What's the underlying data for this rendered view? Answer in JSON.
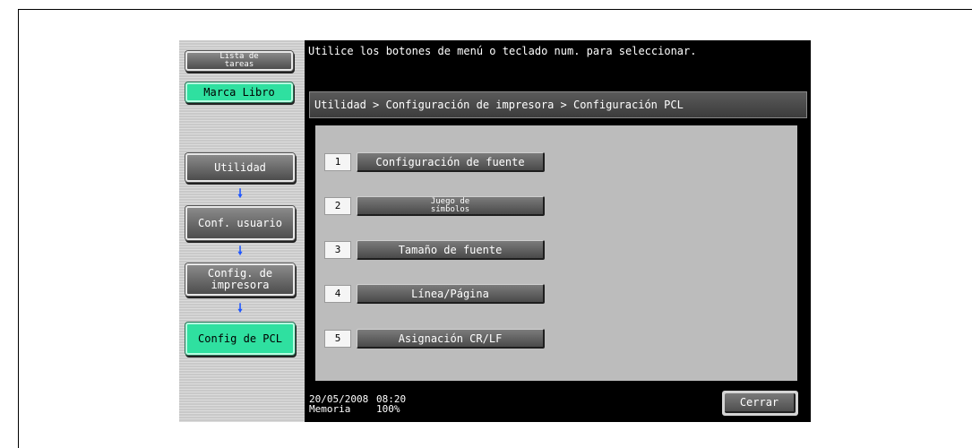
{
  "sidebar": {
    "lista_tareas": "Lista de tareas",
    "marca_libro": "Marca Libro",
    "nav": [
      {
        "label": "Utilidad"
      },
      {
        "label": "Conf. usuario"
      },
      {
        "label": "Config. de impresora"
      },
      {
        "label": "Config de PCL"
      }
    ],
    "arrow_glyph": "🠗"
  },
  "header": {
    "message": "Utilice los botones de menú o teclado num. para seleccionar."
  },
  "breadcrumb": "Utilidad > Configuración de impresora > Configuración PCL",
  "menu": {
    "items": [
      {
        "number": "1",
        "label": "Configuración de fuente"
      },
      {
        "number": "2",
        "label": "Juego de símbolos"
      },
      {
        "number": "3",
        "label": "Tamaño de fuente"
      },
      {
        "number": "4",
        "label": "Línea/Página"
      },
      {
        "number": "5",
        "label": "Asignación CR/LF"
      }
    ]
  },
  "status": {
    "date": "20/05/2008",
    "time": "08:20",
    "memory_label": "Memoria",
    "memory_value": "100%"
  },
  "close_label": "Cerrar",
  "colors": {
    "accent_green": "#2fe0a0",
    "nav_arrow": "#1f56ff"
  }
}
